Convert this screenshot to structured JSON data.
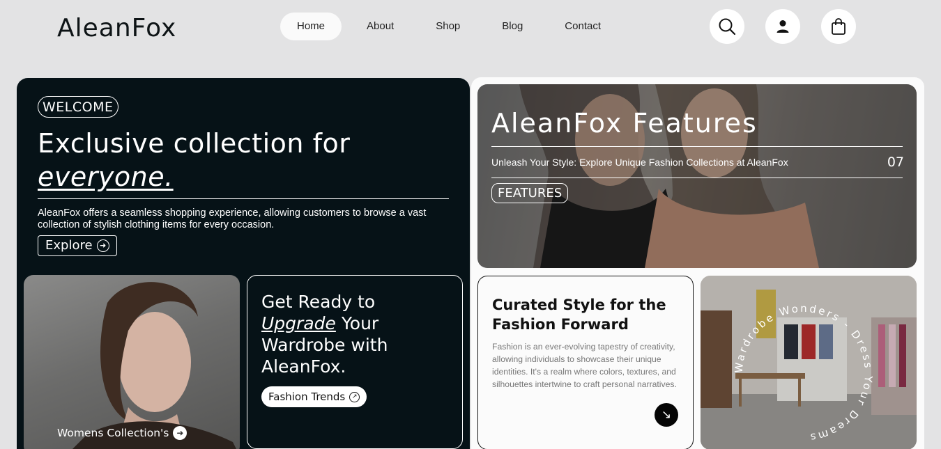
{
  "brand": {
    "logo": "AleanFox"
  },
  "nav": {
    "items": [
      "Home",
      "About",
      "Shop",
      "Blog",
      "Contact"
    ],
    "active": "Home"
  },
  "header_icons": [
    "search-icon",
    "user-icon",
    "shopping-bag-icon"
  ],
  "hero": {
    "badge": "WELCOME",
    "title_line1": "Exclusive collection for",
    "title_line2": "everyone.",
    "description": "AleanFox offers a seamless shopping experience, allowing customers to browse a vast collection of stylish clothing items for every occasion.",
    "explore_label": "Explore"
  },
  "women_card": {
    "label": "Womens Collection's"
  },
  "upgrade_card": {
    "line1": "Get Ready to",
    "highlight": "Upgrade",
    "line2_rest": " Your",
    "line3": "Wardrobe with",
    "line4": "AleanFox.",
    "button_label": "Fashion Trends"
  },
  "features": {
    "title": "AleanFox Features",
    "subtitle": "Unleash Your Style: Explore Unique Fashion Collections at AleanFox",
    "number": "07",
    "badge": "FEATURES"
  },
  "curated": {
    "title": "Curated Style for the Fashion Forward",
    "description": "Fashion is an ever-evolving tapestry of creativity, allowing individuals to showcase their unique identities. It's a realm where colors, textures, and silhouettes intertwine to craft personal narratives."
  },
  "store": {
    "circular_text": "Wardrobe Wonders - Dress Your Dreams"
  },
  "colors": {
    "dark_panel": "#061217",
    "background": "#e3e3e4",
    "accent_black": "#050505"
  }
}
